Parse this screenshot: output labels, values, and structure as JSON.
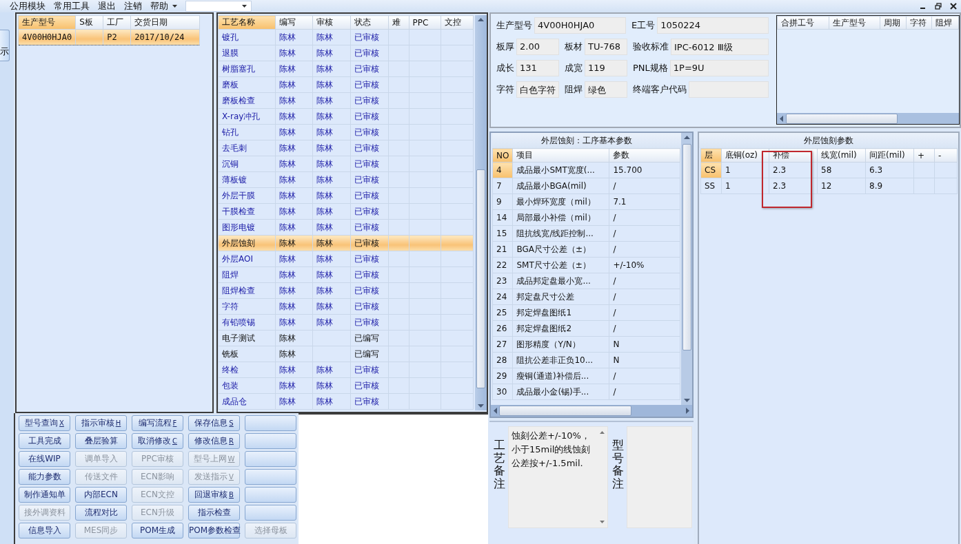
{
  "menu": {
    "items": [
      "公用模块",
      "常用工具",
      "退出",
      "注销",
      "帮助"
    ]
  },
  "side_button": {
    "label": "示"
  },
  "orders": {
    "columns": [
      {
        "label": "生产型号",
        "selected": true
      },
      {
        "label": "S板",
        "selected": false
      },
      {
        "label": "工厂",
        "selected": false
      },
      {
        "label": "交货日期",
        "selected": false
      }
    ],
    "rows": [
      {
        "cells": [
          "4V00H0HJA0",
          "",
          "P2",
          "2017/10/24"
        ],
        "selected": true
      }
    ]
  },
  "process": {
    "columns": [
      {
        "label": "工艺名称",
        "selected": true
      },
      {
        "label": "编写",
        "selected": false
      },
      {
        "label": "审核",
        "selected": false
      },
      {
        "label": "状态",
        "selected": false
      },
      {
        "label": "难",
        "selected": false
      },
      {
        "label": "PPC",
        "selected": false
      },
      {
        "label": "文控",
        "selected": false
      }
    ],
    "rows": [
      {
        "cells": [
          "镀孔",
          "陈林",
          "陈林",
          "已审核",
          "",
          "",
          ""
        ],
        "approved": true,
        "selected": false
      },
      {
        "cells": [
          "退膜",
          "陈林",
          "陈林",
          "已审核",
          "",
          "",
          ""
        ],
        "approved": true,
        "selected": false
      },
      {
        "cells": [
          "树脂塞孔",
          "陈林",
          "陈林",
          "已审核",
          "",
          "",
          ""
        ],
        "approved": true,
        "selected": false
      },
      {
        "cells": [
          "磨板",
          "陈林",
          "陈林",
          "已审核",
          "",
          "",
          ""
        ],
        "approved": true,
        "selected": false
      },
      {
        "cells": [
          "磨板检查",
          "陈林",
          "陈林",
          "已审核",
          "",
          "",
          ""
        ],
        "approved": true,
        "selected": false
      },
      {
        "cells": [
          "X-ray冲孔",
          "陈林",
          "陈林",
          "已审核",
          "",
          "",
          ""
        ],
        "approved": true,
        "selected": false
      },
      {
        "cells": [
          "钻孔",
          "陈林",
          "陈林",
          "已审核",
          "",
          "",
          ""
        ],
        "approved": true,
        "selected": false
      },
      {
        "cells": [
          "去毛刺",
          "陈林",
          "陈林",
          "已审核",
          "",
          "",
          ""
        ],
        "approved": true,
        "selected": false
      },
      {
        "cells": [
          "沉铜",
          "陈林",
          "陈林",
          "已审核",
          "",
          "",
          ""
        ],
        "approved": true,
        "selected": false
      },
      {
        "cells": [
          "薄板镀",
          "陈林",
          "陈林",
          "已审核",
          "",
          "",
          ""
        ],
        "approved": true,
        "selected": false
      },
      {
        "cells": [
          "外层干膜",
          "陈林",
          "陈林",
          "已审核",
          "",
          "",
          ""
        ],
        "approved": true,
        "selected": false
      },
      {
        "cells": [
          "干膜检查",
          "陈林",
          "陈林",
          "已审核",
          "",
          "",
          ""
        ],
        "approved": true,
        "selected": false
      },
      {
        "cells": [
          "图形电镀",
          "陈林",
          "陈林",
          "已审核",
          "",
          "",
          ""
        ],
        "approved": true,
        "selected": false
      },
      {
        "cells": [
          "外层蚀刻",
          "陈林",
          "陈林",
          "已审核",
          "",
          "",
          ""
        ],
        "approved": true,
        "selected": true
      },
      {
        "cells": [
          "外层AOI",
          "陈林",
          "陈林",
          "已审核",
          "",
          "",
          ""
        ],
        "approved": true,
        "selected": false
      },
      {
        "cells": [
          "阻焊",
          "陈林",
          "陈林",
          "已审核",
          "",
          "",
          ""
        ],
        "approved": true,
        "selected": false
      },
      {
        "cells": [
          "阻焊检查",
          "陈林",
          "陈林",
          "已审核",
          "",
          "",
          ""
        ],
        "approved": true,
        "selected": false
      },
      {
        "cells": [
          "字符",
          "陈林",
          "陈林",
          "已审核",
          "",
          "",
          ""
        ],
        "approved": true,
        "selected": false
      },
      {
        "cells": [
          "有铅喷锡",
          "陈林",
          "陈林",
          "已审核",
          "",
          "",
          ""
        ],
        "approved": true,
        "selected": false
      },
      {
        "cells": [
          "电子测试",
          "陈林",
          "",
          "已编写",
          "",
          "",
          ""
        ],
        "approved": false,
        "selected": false
      },
      {
        "cells": [
          "铣板",
          "陈林",
          "",
          "已编写",
          "",
          "",
          ""
        ],
        "approved": false,
        "selected": false
      },
      {
        "cells": [
          "终检",
          "陈林",
          "陈林",
          "已审核",
          "",
          "",
          ""
        ],
        "approved": true,
        "selected": false
      },
      {
        "cells": [
          "包装",
          "陈林",
          "陈林",
          "已审核",
          "",
          "",
          ""
        ],
        "approved": true,
        "selected": false
      },
      {
        "cells": [
          "成品仓",
          "陈林",
          "陈林",
          "已审核",
          "",
          "",
          ""
        ],
        "approved": true,
        "selected": false
      }
    ]
  },
  "buttons": [
    [
      {
        "label": "型号查询",
        "hotkey": "X",
        "disabled": false
      },
      {
        "label": "指示审核",
        "hotkey": "H",
        "disabled": false
      },
      {
        "label": "编写流程",
        "hotkey": "F",
        "disabled": false
      },
      {
        "label": "保存信息",
        "hotkey": "S",
        "disabled": false
      },
      {
        "disabled": false
      }
    ],
    [
      {
        "label": "工具完成",
        "disabled": false
      },
      {
        "label": "叠层验算",
        "disabled": false
      },
      {
        "label": "取消修改",
        "hotkey": "C",
        "disabled": false
      },
      {
        "label": "修改信息",
        "hotkey": "R",
        "disabled": false
      },
      {
        "disabled": false
      }
    ],
    [
      {
        "label": "在线WIP",
        "disabled": false
      },
      {
        "label": "调单导入",
        "disabled": true
      },
      {
        "label": "PPC审核",
        "disabled": true
      },
      {
        "label": "型号上网",
        "hotkey": "W",
        "disabled": true
      },
      {
        "disabled": false
      }
    ],
    [
      {
        "label": "能力参数",
        "disabled": false
      },
      {
        "label": "传送文件",
        "disabled": true
      },
      {
        "label": "ECN影响",
        "disabled": true
      },
      {
        "label": "发送指示",
        "hotkey": "V",
        "disabled": true
      },
      {
        "disabled": false
      }
    ],
    [
      {
        "label": "制作通知单",
        "disabled": false
      },
      {
        "label": "内部ECN",
        "disabled": false
      },
      {
        "label": "ECN文控",
        "disabled": true
      },
      {
        "label": "回退审核",
        "hotkey": "B",
        "disabled": false
      },
      {
        "disabled": false
      }
    ],
    [
      {
        "label": "接外调资料",
        "disabled": true
      },
      {
        "label": "流程对比",
        "disabled": false
      },
      {
        "label": "ECN升级",
        "disabled": true
      },
      {
        "label": "指示检查",
        "disabled": false
      },
      {
        "disabled": false
      }
    ],
    [
      {
        "label": "信息导入",
        "disabled": false
      },
      {
        "label": "MES同步",
        "disabled": true
      },
      {
        "label": "POM生成",
        "disabled": false
      },
      {
        "label": "POM参数检查",
        "disabled": false
      },
      {
        "label": "选择母板",
        "disabled": true
      }
    ]
  ],
  "info": {
    "rows": [
      {
        "fields": [
          {
            "label": "生产型号",
            "value": "4V00H0HJA0"
          },
          {
            "label": "E工号",
            "value": "1050224"
          }
        ]
      },
      {
        "fields": [
          {
            "label": "板厚",
            "value": "2.00"
          },
          {
            "label": "板材",
            "value": "TU-768"
          },
          {
            "label": "验收标准",
            "value": "IPC-6012 Ⅲ级"
          }
        ]
      },
      {
        "fields": [
          {
            "label": "成长",
            "value": "131"
          },
          {
            "label": "成宽",
            "value": "119"
          },
          {
            "label": "PNL规格",
            "value": "1P=9U"
          }
        ]
      },
      {
        "fields": [
          {
            "label": "字符",
            "value": "白色字符"
          },
          {
            "label": "阻焊",
            "value": "绿色"
          },
          {
            "label": "终端客户代码"
          }
        ]
      }
    ]
  },
  "merge_table": {
    "columns": [
      "合拼工号",
      "生产型号",
      "周期",
      "字符",
      "阻焊"
    ]
  },
  "params_panel": {
    "title": "外层蚀刻：工序基本参数",
    "columns": [
      {
        "label": "NO",
        "selected": true
      },
      {
        "label": "项目",
        "selected": false
      },
      {
        "label": "参数",
        "selected": false
      }
    ],
    "rows": [
      {
        "cells": [
          "4",
          "成品最小SMT宽度(...",
          "15.700"
        ],
        "selected": true
      },
      {
        "cells": [
          "7",
          "成品最小BGA(mil)",
          "/"
        ],
        "selected": false
      },
      {
        "cells": [
          "9",
          "最小焊环宽度（mil）",
          "7.1"
        ],
        "selected": false
      },
      {
        "cells": [
          "14",
          "局部最小补偿（mil）",
          "/"
        ],
        "selected": false
      },
      {
        "cells": [
          "15",
          "阻抗线宽/线距控制...",
          "/"
        ],
        "selected": false
      },
      {
        "cells": [
          "21",
          "BGA尺寸公差（±）",
          "/"
        ],
        "selected": false
      },
      {
        "cells": [
          "22",
          "SMT尺寸公差（±）",
          "+/-10%"
        ],
        "selected": false
      },
      {
        "cells": [
          "23",
          "成品邦定盘最小宽...",
          "/"
        ],
        "selected": false
      },
      {
        "cells": [
          "24",
          "邦定盘尺寸公差",
          "/"
        ],
        "selected": false
      },
      {
        "cells": [
          "25",
          "邦定焊盘图纸1",
          "/"
        ],
        "selected": false
      },
      {
        "cells": [
          "26",
          "邦定焊盘图纸2",
          "/"
        ],
        "selected": false
      },
      {
        "cells": [
          "27",
          "图形精度（Y/N）",
          "N"
        ],
        "selected": false
      },
      {
        "cells": [
          "28",
          "阻抗公差非正负10...",
          "N"
        ],
        "selected": false
      },
      {
        "cells": [
          "29",
          "瘦铜(通道)补偿后...",
          "/"
        ],
        "selected": false
      },
      {
        "cells": [
          "30",
          "成品最小金(锡)手...",
          "/"
        ],
        "selected": false
      }
    ]
  },
  "remarks": [
    {
      "label": "工艺备注",
      "text": "蚀刻公差+/-10%，小于15mil的线蚀刻公差按+/-1.5mil.",
      "scrollable": true
    },
    {
      "label": "型号备注",
      "scrollable": false
    }
  ],
  "etch_panel": {
    "title": "外层蚀刻参数",
    "columns": [
      {
        "label": "层",
        "selected": true,
        "marked": false
      },
      {
        "label": "底铜(oz)",
        "selected": false,
        "marked": false
      },
      {
        "label": "补偿",
        "selected": false,
        "marked": true
      },
      {
        "label": "线宽(mil)",
        "selected": false,
        "marked": false
      },
      {
        "label": "间距(mil)",
        "selected": false,
        "marked": false
      },
      {
        "label": "+",
        "selected": false,
        "marked": false
      },
      {
        "label": "-",
        "selected": false,
        "marked": false
      }
    ],
    "rows": [
      {
        "cells": [
          "CS",
          "1",
          "2.3",
          "58",
          "6.3",
          "",
          ""
        ],
        "selected": true
      },
      {
        "cells": [
          "SS",
          "1",
          "2.3",
          "12",
          "8.9",
          "",
          ""
        ],
        "selected": false
      }
    ]
  }
}
